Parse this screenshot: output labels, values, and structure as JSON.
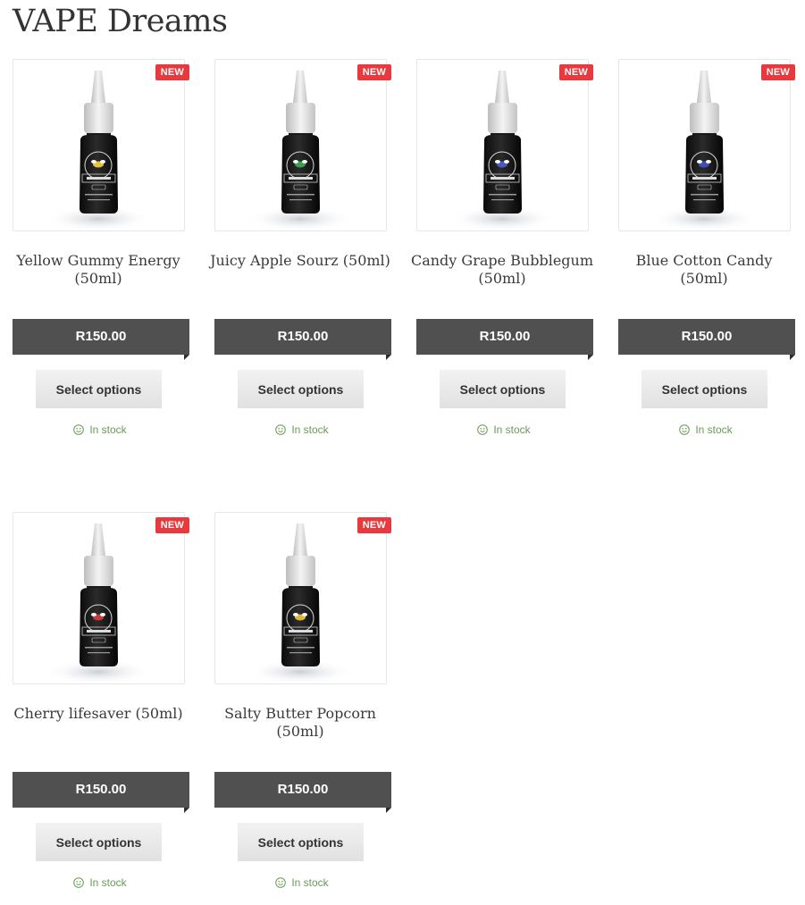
{
  "page": {
    "title": "VAPE Dreams"
  },
  "products": [
    {
      "name": "Yellow Gummy Energy (50ml)",
      "badge": "NEW",
      "price": "R150.00",
      "button": "Select options",
      "stock": "In stock",
      "accent": "#e8c43a"
    },
    {
      "name": "Juicy Apple Sourz (50ml)",
      "badge": "NEW",
      "price": "R150.00",
      "button": "Select options",
      "stock": "In stock",
      "accent": "#3aa04a"
    },
    {
      "name": "Candy Grape Bubblegum (50ml)",
      "badge": "NEW",
      "price": "R150.00",
      "button": "Select options",
      "stock": "In stock",
      "accent": "#4a56c4"
    },
    {
      "name": "Blue Cotton Candy (50ml)",
      "badge": "NEW",
      "price": "R150.00",
      "button": "Select options",
      "stock": "In stock",
      "accent": "#3e4fb8"
    },
    {
      "name": "Cherry lifesaver (50ml)",
      "badge": "NEW",
      "price": "R150.00",
      "button": "Select options",
      "stock": "In stock",
      "accent": "#c83a3a"
    },
    {
      "name": "Salty Butter Popcorn (50ml)",
      "badge": "NEW",
      "price": "R150.00",
      "button": "Select options",
      "stock": "In stock",
      "accent": "#e0b73a"
    }
  ],
  "colors": {
    "badge": "#e7393e",
    "price_bar": "#505050",
    "stock_text": "#6a9a55"
  },
  "icons": {
    "stock": "smiley-icon",
    "product_image": "bottle-icon"
  }
}
